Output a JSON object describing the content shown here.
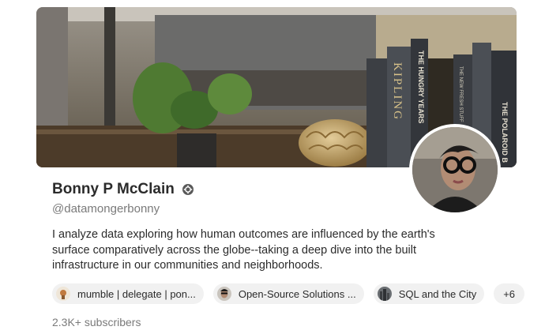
{
  "profile": {
    "name": "Bonny P McClain",
    "verified_icon": "badge-icon",
    "handle": "@datamongerbonny",
    "bio": "I analyze data exploring how human outcomes are influenced by the earth's surface comparatively across the globe--taking a deep dive into the built infrastructure in our communities and neighborhoods.",
    "subscribers": "2.3K+ subscribers"
  },
  "banner": {
    "book_titles": [
      "KIPLING",
      "THE HUNGRY YEARS",
      "THE NEW FRESH STUFF",
      "THE POLAROID B"
    ]
  },
  "publications": [
    {
      "label": "mumble | delegate | pon..."
    },
    {
      "label": "Open-Source Solutions ..."
    },
    {
      "label": "SQL and the City"
    }
  ],
  "more_publications": "+6"
}
